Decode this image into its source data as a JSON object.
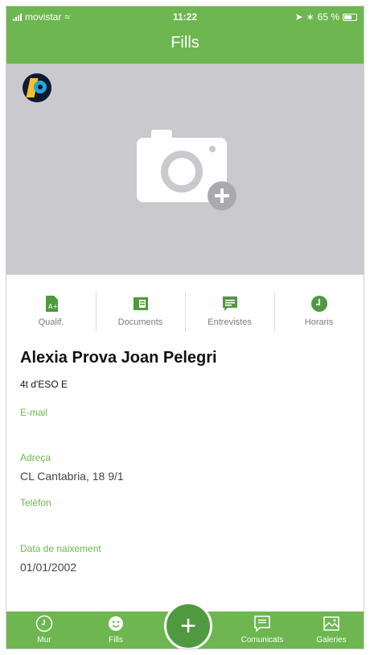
{
  "status_bar": {
    "carrier": "movistar",
    "time": "11:22",
    "battery": "65 %"
  },
  "header": {
    "title": "Fills"
  },
  "shortcuts": [
    {
      "label": "Qualif.",
      "icon": "grade-doc-icon"
    },
    {
      "label": "Documents",
      "icon": "document-icon"
    },
    {
      "label": "Entrevistes",
      "icon": "chat-icon"
    },
    {
      "label": "Horaris",
      "icon": "clock-icon"
    }
  ],
  "profile": {
    "name": "Alexia Prova Joan Pelegri",
    "course": "4t d'ESO E",
    "fields": [
      {
        "label": "E-mail",
        "value": ""
      },
      {
        "label": "Adreça",
        "value": "CL Cantabria, 18 9/1"
      },
      {
        "label": "Telèfon",
        "value": ""
      },
      {
        "label": "Data de naixement",
        "value": "01/01/2002"
      }
    ]
  },
  "tabbar": {
    "items": [
      {
        "label": "Mur",
        "icon": "clock-icon"
      },
      {
        "label": "Fills",
        "icon": "smiley-icon"
      },
      {
        "label": "Comunicats",
        "icon": "message-icon"
      },
      {
        "label": "Galeries",
        "icon": "gallery-icon"
      }
    ],
    "fab_label": "+"
  },
  "colors": {
    "accent": "#6db650",
    "accent_dark": "#4f9a3f",
    "hero_bg": "#c9c9ce"
  }
}
